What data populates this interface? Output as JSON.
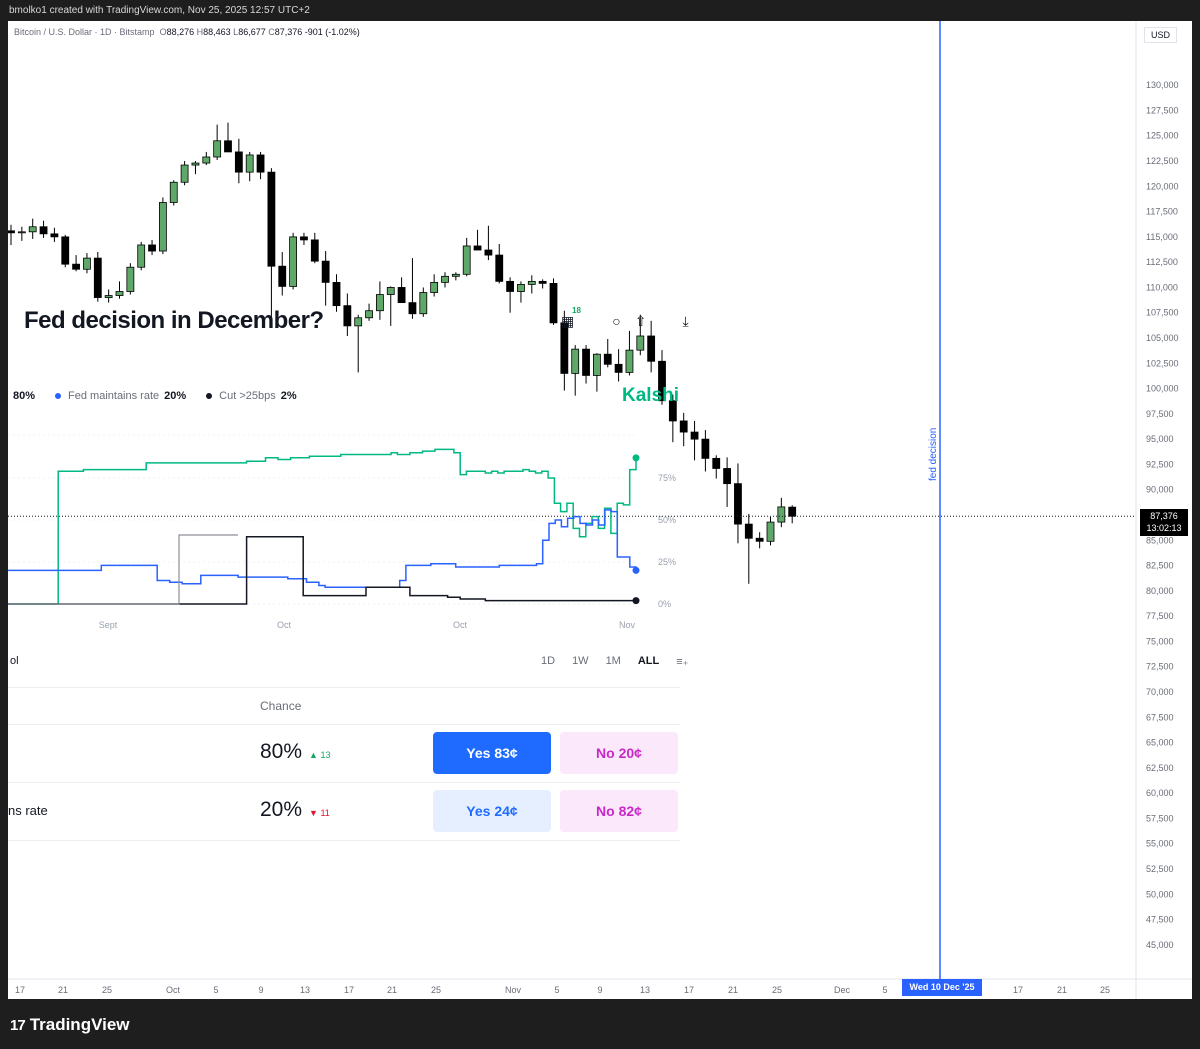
{
  "header": {
    "created_text": "bmolko1 created with TradingView.com, Nov 25, 2025 12:57 UTC+2"
  },
  "legend": {
    "symbol": "Bitcoin / U.S. Dollar · 1D · Bitstamp",
    "open_label": "O",
    "open": "88,276",
    "high_label": "H",
    "high": "88,463",
    "low_label": "L",
    "low": "86,677",
    "close_label": "C",
    "close": "87,376",
    "change": "-901 (-1.02%)"
  },
  "currency": "USD",
  "price_tag": {
    "price": "87,376",
    "countdown": "13:02:13"
  },
  "vline": {
    "label": "fed decision",
    "date_tag": "Wed 10 Dec '25"
  },
  "overlay": {
    "title": "Fed decision in December?",
    "brand": "Kalshi",
    "badge": "18",
    "options": [
      {
        "label": "",
        "pct": "80%",
        "color": "#00b982"
      },
      {
        "label": "Fed maintains rate",
        "pct": "20%",
        "color": "#2962ff"
      },
      {
        "label": "Cut >25bps",
        "pct": "2%",
        "color": "#131722"
      }
    ],
    "range_left": "ol",
    "range_buttons": [
      "1D",
      "1W",
      "1M",
      "ALL"
    ],
    "range_active": "ALL",
    "table_header": "Chance",
    "rows": [
      {
        "name": "",
        "chance": "80%",
        "delta": "▲ 13",
        "dir": "up",
        "yes": "Yes 83¢",
        "no": "No 20¢"
      },
      {
        "name": "ns rate",
        "chance": "20%",
        "delta": "▼ 11",
        "dir": "down",
        "yes": "Yes 24¢",
        "no": "No 82¢"
      }
    ],
    "inner_x_labels": [
      "Sept",
      "Oct",
      "Oct",
      "Nov"
    ],
    "inner_y_labels": [
      "75%",
      "50%",
      "25%",
      "0%"
    ]
  },
  "chart_data": {
    "type": "candlestick",
    "title": "Bitcoin / U.S. Dollar · 1D · Bitstamp",
    "price_axis": [
      "130,000",
      "127,500",
      "125,000",
      "122,500",
      "120,000",
      "117,500",
      "115,000",
      "112,500",
      "110,000",
      "107,500",
      "105,000",
      "102,500",
      "100,000",
      "97,500",
      "95,000",
      "92,500",
      "90,000",
      "87,500",
      "85,000",
      "82,500",
      "80,000",
      "77,500",
      "75,000",
      "72,500",
      "70,000",
      "67,500",
      "65,000",
      "62,500",
      "60,000",
      "57,500",
      "55,000",
      "52,500",
      "50,000",
      "47,500",
      "45,000"
    ],
    "ylim": [
      43500,
      131500
    ],
    "time_axis": [
      "17",
      "21",
      "25",
      "Oct",
      "5",
      "9",
      "13",
      "17",
      "21",
      "25",
      "Nov",
      "5",
      "9",
      "13",
      "17",
      "21",
      "25",
      "Dec",
      "5",
      "Wed 10 Dec '25",
      "17",
      "21",
      "25"
    ],
    "ohlc": [
      [
        115600,
        116200,
        114200,
        115400
      ],
      [
        115400,
        116000,
        114600,
        115500
      ],
      [
        115500,
        116800,
        114800,
        116000
      ],
      [
        116000,
        116600,
        114900,
        115300
      ],
      [
        115300,
        115900,
        114500,
        115000
      ],
      [
        115000,
        115200,
        112000,
        112300
      ],
      [
        112300,
        113200,
        111600,
        111800
      ],
      [
        111800,
        113400,
        111400,
        112900
      ],
      [
        112900,
        113500,
        108600,
        109000
      ],
      [
        109000,
        109800,
        108500,
        109200
      ],
      [
        109200,
        110600,
        108900,
        109600
      ],
      [
        109600,
        112400,
        109300,
        112000
      ],
      [
        112000,
        114500,
        111700,
        114200
      ],
      [
        114200,
        114700,
        113200,
        113600
      ],
      [
        113600,
        118900,
        113300,
        118400
      ],
      [
        118400,
        120600,
        118100,
        120400
      ],
      [
        120400,
        122500,
        120100,
        122100
      ],
      [
        122100,
        122500,
        121200,
        122300
      ],
      [
        122300,
        123400,
        122100,
        122900
      ],
      [
        122900,
        126100,
        122600,
        124500
      ],
      [
        124500,
        126300,
        123800,
        123400
      ],
      [
        123400,
        124700,
        120300,
        121400
      ],
      [
        121400,
        123400,
        120500,
        123100
      ],
      [
        123100,
        123400,
        120700,
        121400
      ],
      [
        121400,
        121800,
        107000,
        112100
      ],
      [
        112100,
        113500,
        109200,
        110100
      ],
      [
        110100,
        115400,
        109800,
        115000
      ],
      [
        115000,
        115400,
        114200,
        114700
      ],
      [
        114700,
        115400,
        112400,
        112600
      ],
      [
        112600,
        113600,
        108200,
        110500
      ],
      [
        110500,
        111300,
        107600,
        108200
      ],
      [
        108200,
        109400,
        105200,
        106200
      ],
      [
        106200,
        107300,
        101600,
        107000
      ],
      [
        107000,
        108400,
        106700,
        107700
      ],
      [
        107700,
        110600,
        106800,
        109300
      ],
      [
        109300,
        110100,
        106200,
        110000
      ],
      [
        110000,
        111000,
        108500,
        108500
      ],
      [
        108500,
        112900,
        106900,
        107400
      ],
      [
        107400,
        110000,
        107100,
        109500
      ],
      [
        109500,
        111300,
        109100,
        110500
      ],
      [
        110500,
        111500,
        110000,
        111100
      ],
      [
        111100,
        111500,
        110700,
        111300
      ],
      [
        111300,
        114900,
        111100,
        114100
      ],
      [
        114100,
        115700,
        113800,
        113700
      ],
      [
        113700,
        116100,
        112700,
        113200
      ],
      [
        113200,
        114300,
        110400,
        110600
      ],
      [
        110600,
        111000,
        107500,
        109600
      ],
      [
        109600,
        110600,
        108500,
        110300
      ],
      [
        110300,
        111200,
        109400,
        110600
      ],
      [
        110600,
        110800,
        109900,
        110400
      ],
      [
        110400,
        110900,
        106300,
        106500
      ],
      [
        106500,
        107700,
        99800,
        101500
      ],
      [
        101500,
        104300,
        99300,
        103900
      ],
      [
        103900,
        104300,
        100500,
        101300
      ],
      [
        101300,
        103500,
        99700,
        103400
      ],
      [
        103400,
        104900,
        102100,
        102400
      ],
      [
        102400,
        103900,
        100700,
        101600
      ],
      [
        101600,
        105700,
        101300,
        103800
      ],
      [
        103800,
        107300,
        103300,
        105200
      ],
      [
        105200,
        106700,
        101600,
        102700
      ],
      [
        102700,
        103800,
        98400,
        98800
      ],
      [
        98800,
        99400,
        94700,
        96800
      ],
      [
        96800,
        97600,
        94300,
        95700
      ],
      [
        95700,
        96800,
        92900,
        95000
      ],
      [
        95000,
        95900,
        91800,
        93100
      ],
      [
        93100,
        93400,
        91100,
        92100
      ],
      [
        92100,
        93200,
        88300,
        90600
      ],
      [
        90600,
        92600,
        84700,
        86600
      ],
      [
        86600,
        87600,
        80700,
        85200
      ],
      [
        85200,
        85800,
        84200,
        84900
      ],
      [
        84900,
        87300,
        84500,
        86800
      ],
      [
        86800,
        89200,
        86300,
        88300
      ],
      [
        88276,
        88463,
        86677,
        87376
      ]
    ],
    "prediction_series": [
      {
        "name": "",
        "color": "#00b982",
        "values": [
          0,
          0,
          0,
          0,
          0,
          0,
          0,
          0,
          79,
          79,
          79,
          79,
          80,
          80,
          80,
          80,
          80,
          80,
          80,
          80,
          80,
          80,
          84,
          84,
          84,
          84,
          84,
          84,
          84,
          84,
          84,
          84,
          84,
          84,
          84,
          84,
          84,
          84,
          85,
          85,
          85,
          87,
          87,
          86,
          86,
          87,
          87,
          87,
          88,
          88,
          88,
          88,
          88,
          89,
          89,
          89,
          89,
          89,
          89,
          89,
          89,
          90,
          89,
          89,
          90,
          90,
          91,
          91,
          92,
          92,
          92,
          90,
          77,
          79,
          79,
          79,
          78,
          79,
          78,
          79,
          79,
          79,
          80,
          79,
          78,
          79,
          75,
          60,
          55,
          60,
          45,
          40,
          48,
          52,
          45,
          57,
          42,
          60,
          59,
          80,
          87
        ]
      },
      {
        "name": "Fed maintains rate",
        "color": "#2962ff",
        "values": [
          20,
          20,
          20,
          20,
          20,
          20,
          20,
          20,
          20,
          20,
          20,
          20,
          20,
          20,
          20,
          23,
          23,
          23,
          23,
          23,
          23,
          23,
          23,
          23,
          14,
          14,
          13,
          13,
          12,
          12,
          12,
          17,
          17,
          17,
          17,
          17,
          17,
          16,
          16,
          16,
          16,
          16,
          16,
          16,
          16,
          15,
          15,
          15,
          13,
          13,
          11,
          10,
          10,
          10,
          10,
          10,
          10,
          10,
          10,
          10,
          10,
          10,
          10,
          14,
          23,
          23,
          23,
          23,
          24,
          24,
          24,
          24,
          22,
          22,
          22,
          22,
          22,
          22,
          22,
          23,
          23,
          23,
          23,
          23,
          23,
          24,
          38,
          48,
          50,
          46,
          51,
          52,
          48,
          47,
          50,
          47,
          56,
          55,
          28,
          28,
          22,
          20
        ]
      },
      {
        "name": "Cut >25bps",
        "color": "#131722",
        "values": [
          0,
          0,
          0,
          0,
          0,
          0,
          0,
          0,
          0,
          0,
          0,
          0,
          0,
          0,
          0,
          0,
          0,
          0,
          0,
          0,
          0,
          0,
          0,
          0,
          0,
          0,
          0,
          0,
          0,
          0,
          0,
          0,
          0,
          0,
          0,
          0,
          0,
          0,
          40,
          40,
          40,
          40,
          40,
          40,
          40,
          40,
          40,
          5,
          5,
          5,
          5,
          5,
          5,
          5,
          5,
          5,
          5,
          10,
          10,
          10,
          10,
          10,
          10,
          10,
          5,
          5,
          5,
          5,
          5,
          5,
          4,
          4,
          3,
          3,
          3,
          3,
          2,
          2,
          2,
          2,
          2,
          2,
          2,
          2,
          2,
          2,
          2,
          2,
          2,
          2,
          2,
          2,
          2,
          2,
          2,
          2,
          2,
          2,
          2,
          2,
          2
        ]
      }
    ],
    "current_price": 87376
  }
}
